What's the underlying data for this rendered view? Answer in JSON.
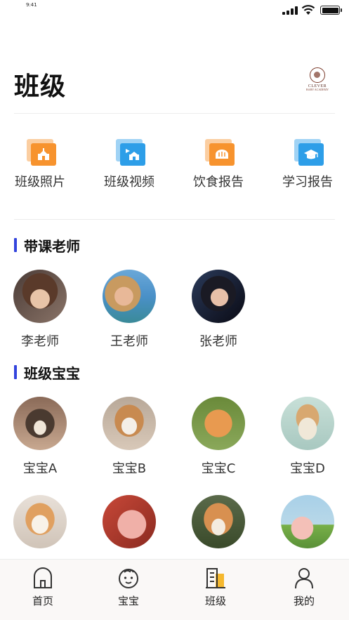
{
  "status_bar": {
    "time": "9:41"
  },
  "header": {
    "title": "班级",
    "logo_text": "CLEVER",
    "logo_sub": "BABY ACADEMY"
  },
  "quick_menu": [
    {
      "label": "班级照片",
      "icon": "class-photo-icon",
      "color": "#f7932e"
    },
    {
      "label": "班级视频",
      "icon": "class-video-icon",
      "color": "#2d9ee8"
    },
    {
      "label": "饮食报告",
      "icon": "diet-report-icon",
      "color": "#f7932e"
    },
    {
      "label": "学习报告",
      "icon": "study-report-icon",
      "color": "#2d9ee8"
    }
  ],
  "teachers_section": {
    "title": "带课老师",
    "items": [
      {
        "name": "李老师"
      },
      {
        "name": "王老师"
      },
      {
        "name": "张老师"
      }
    ]
  },
  "babies_section": {
    "title": "班级宝宝",
    "items": [
      {
        "name": "宝宝A"
      },
      {
        "name": "宝宝B"
      },
      {
        "name": "宝宝C"
      },
      {
        "name": "宝宝D"
      },
      {
        "name": ""
      },
      {
        "name": ""
      },
      {
        "name": ""
      },
      {
        "name": ""
      }
    ]
  },
  "tabbar": {
    "items": [
      {
        "label": "首页",
        "icon": "home-icon"
      },
      {
        "label": "宝宝",
        "icon": "baby-face-icon"
      },
      {
        "label": "班级",
        "icon": "class-building-icon"
      },
      {
        "label": "我的",
        "icon": "person-icon"
      }
    ]
  },
  "colors": {
    "accent": "#3344dd",
    "orange": "#f7932e",
    "blue": "#2d9ee8",
    "tab_yellow": "#f5b82e"
  }
}
